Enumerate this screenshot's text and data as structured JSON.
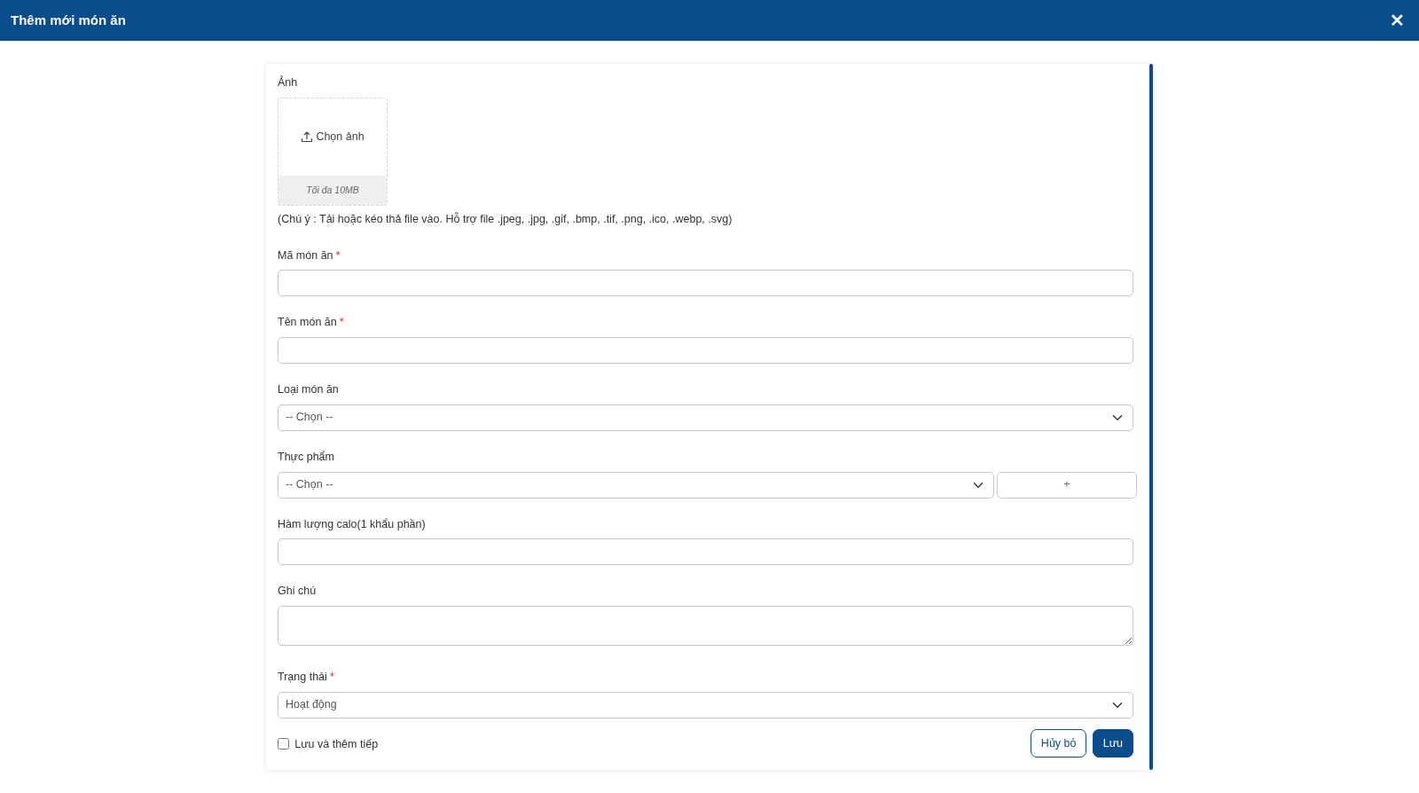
{
  "window": {
    "title": "Thêm mới món ăn",
    "close": "✕"
  },
  "image_upload": {
    "label": "Ảnh",
    "button": "Chọn ảnh",
    "limit": "Tối đa 10MB",
    "note": "(Chú ý : Tải hoặc kéo thả file vào. Hỗ trợ file .jpeg, .jpg, .gif, .bmp, .tif, .png, .ico, .webp, .svg)"
  },
  "fields": [
    {
      "kind": "text",
      "label": "Mã món ăn",
      "required_mark": "*"
    },
    {
      "kind": "text",
      "label": "Tên món ăn",
      "required_mark": "*"
    },
    {
      "kind": "select",
      "label": "Loại món ăn",
      "value": "-- Chọn --"
    },
    {
      "kind": "select_add",
      "label": "Thực phẩm",
      "value": "-- Chọn --",
      "add_button": "+"
    },
    {
      "kind": "text",
      "label": "Hàm lượng calo(1 khẩu phần)"
    },
    {
      "kind": "textarea",
      "label": "Ghi chú"
    },
    {
      "kind": "select",
      "label": "Trạng thái",
      "required_mark": "*",
      "value": "Hoạt động"
    }
  ],
  "save_and_continue": {
    "label": "Lưu và thêm tiếp",
    "checked": false
  },
  "buttons": [
    {
      "kind": "cancel",
      "label": "Hủy bỏ"
    },
    {
      "kind": "save",
      "label": "Lưu"
    }
  ]
}
